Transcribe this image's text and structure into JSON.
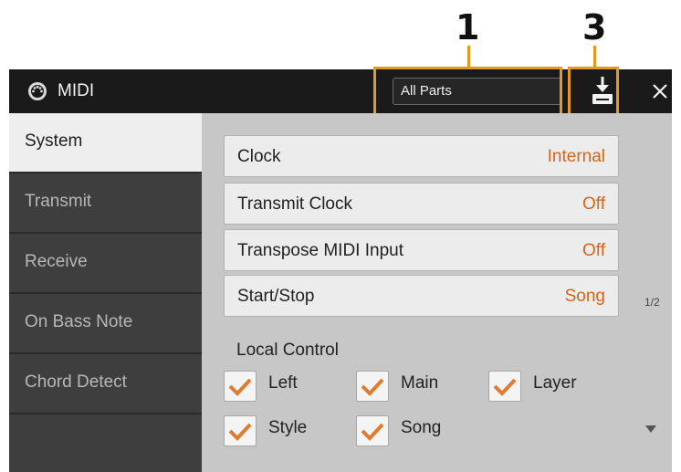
{
  "callouts": {
    "dropdown_number": "1",
    "save_number": "3"
  },
  "titlebar": {
    "title": "MIDI",
    "part_selector": "All Parts"
  },
  "tabs": [
    {
      "label": "System",
      "active": true
    },
    {
      "label": "Transmit"
    },
    {
      "label": "Receive"
    },
    {
      "label": "On Bass Note"
    },
    {
      "label": "Chord Detect"
    }
  ],
  "settings": [
    {
      "label": "Clock",
      "value": "Internal"
    },
    {
      "label": "Transmit Clock",
      "value": "Off"
    },
    {
      "label": "Transpose MIDI Input",
      "value": "Off"
    },
    {
      "label": "Start/Stop",
      "value": "Song"
    }
  ],
  "page_indicator": "1/2",
  "local_control": {
    "title": "Local Control",
    "items": [
      {
        "label": "Left",
        "checked": true
      },
      {
        "label": "Main",
        "checked": true
      },
      {
        "label": "Layer",
        "checked": true
      },
      {
        "label": "Style",
        "checked": true
      },
      {
        "label": "Song",
        "checked": true
      }
    ]
  },
  "colors": {
    "accent": "#e59a1f",
    "value_text": "#d4661a",
    "check": "#e07a2e",
    "titlebar": "#1a1a1a"
  },
  "icons": {
    "app": "midi-connector-icon",
    "save": "save-icon",
    "close": "close-icon",
    "scroll": "scroll-down-arrow-icon"
  }
}
